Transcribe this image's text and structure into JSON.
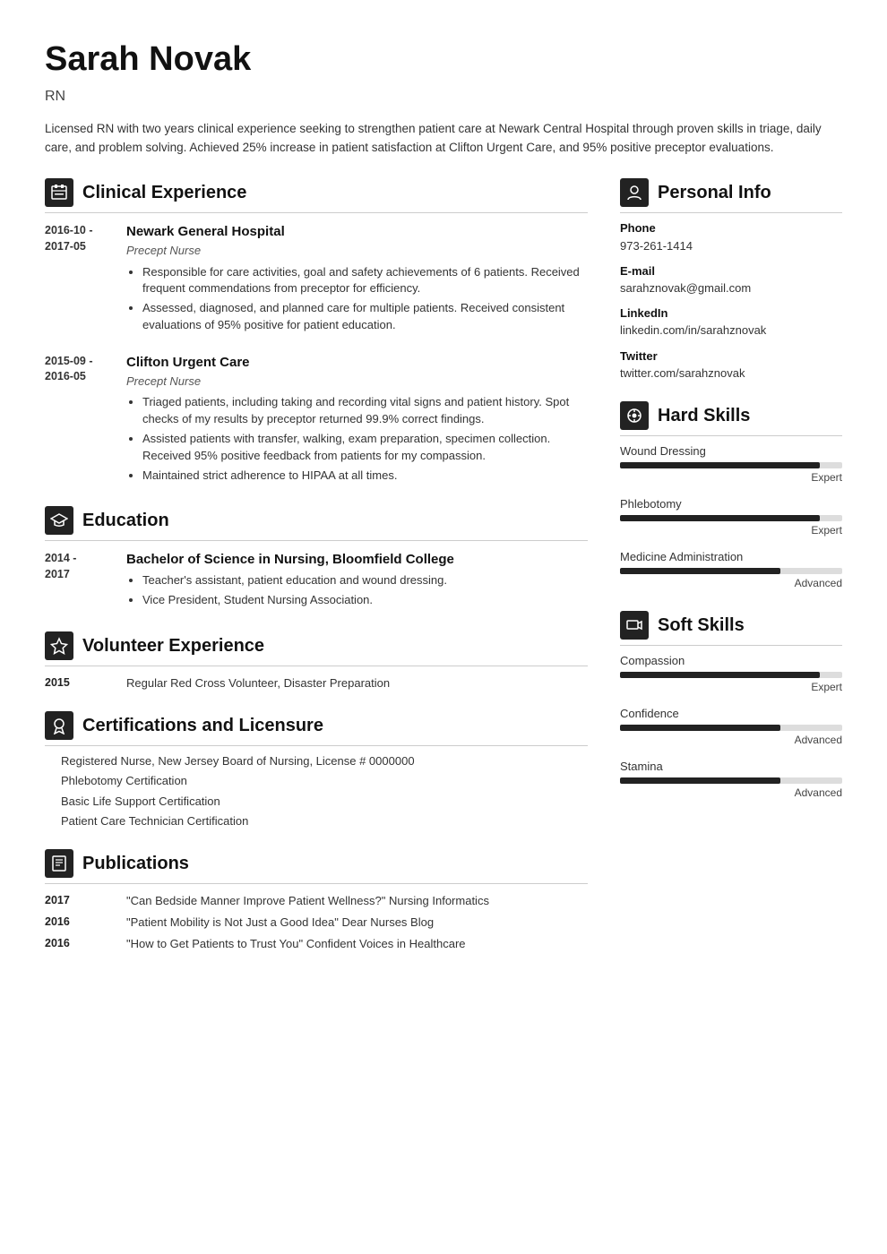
{
  "header": {
    "name": "Sarah Novak",
    "title": "RN",
    "summary": "Licensed RN with two years clinical experience seeking to strengthen patient care at Newark Central Hospital through proven skills in triage, daily care, and problem solving. Achieved 25% increase in patient satisfaction at Clifton Urgent Care, and 95% positive preceptor evaluations."
  },
  "sections": {
    "clinical_experience": {
      "title": "Clinical Experience",
      "entries": [
        {
          "date": "2016-10 -\n2017-05",
          "org": "Newark General Hospital",
          "role": "Precept Nurse",
          "bullets": [
            "Responsible for care activities, goal and safety achievements of 6 patients. Received frequent commendations from preceptor for efficiency.",
            "Assessed, diagnosed, and planned care for multiple patients. Received consistent evaluations of 95% positive for patient education."
          ]
        },
        {
          "date": "2015-09 -\n2016-05",
          "org": "Clifton Urgent Care",
          "role": "Precept Nurse",
          "bullets": [
            "Triaged patients, including taking and recording vital signs and patient history. Spot checks of my results by preceptor returned 99.9% correct findings.",
            "Assisted patients with transfer, walking, exam preparation, specimen collection. Received 95% positive feedback from patients for my compassion.",
            "Maintained strict adherence to HIPAA at all times."
          ]
        }
      ]
    },
    "education": {
      "title": "Education",
      "entries": [
        {
          "date": "2014 -\n2017",
          "title": "Bachelor of Science in Nursing, Bloomfield College",
          "bullets": [
            "Teacher's assistant, patient education and wound dressing.",
            "Vice President, Student Nursing Association."
          ]
        }
      ]
    },
    "volunteer": {
      "title": "Volunteer Experience",
      "entries": [
        {
          "date": "2015",
          "text": "Regular Red Cross Volunteer, Disaster Preparation"
        }
      ]
    },
    "certifications": {
      "title": "Certifications and Licensure",
      "items": [
        "Registered Nurse, New Jersey Board of Nursing, License # 0000000",
        "Phlebotomy Certification",
        "Basic Life Support Certification",
        "Patient Care Technician Certification"
      ]
    },
    "publications": {
      "title": "Publications",
      "entries": [
        {
          "year": "2017",
          "text": "\"Can Bedside Manner Improve Patient Wellness?\" Nursing Informatics"
        },
        {
          "year": "2016",
          "text": "\"Patient Mobility is Not Just a Good Idea\" Dear Nurses Blog"
        },
        {
          "year": "2016",
          "text": "\"How to Get Patients to Trust You\" Confident Voices in Healthcare"
        }
      ]
    }
  },
  "right": {
    "personal_info": {
      "title": "Personal Info",
      "items": [
        {
          "label": "Phone",
          "value": "973-261-1414"
        },
        {
          "label": "E-mail",
          "value": "sarahznovak@gmail.com"
        },
        {
          "label": "LinkedIn",
          "value": "linkedin.com/in/sarahznovak"
        },
        {
          "label": "Twitter",
          "value": "twitter.com/sarahznovak"
        }
      ]
    },
    "hard_skills": {
      "title": "Hard Skills",
      "items": [
        {
          "name": "Wound Dressing",
          "level": "Expert",
          "pct": 90
        },
        {
          "name": "Phlebotomy",
          "level": "Expert",
          "pct": 90
        },
        {
          "name": "Medicine Administration",
          "level": "Advanced",
          "pct": 72
        }
      ]
    },
    "soft_skills": {
      "title": "Soft Skills",
      "items": [
        {
          "name": "Compassion",
          "level": "Expert",
          "pct": 90
        },
        {
          "name": "Confidence",
          "level": "Advanced",
          "pct": 72
        },
        {
          "name": "Stamina",
          "level": "Advanced",
          "pct": 72
        }
      ]
    }
  },
  "icons": {
    "clinical": "🗂",
    "education": "🎓",
    "volunteer": "⭐",
    "certifications": "🏅",
    "publications": "📋",
    "personal_info": "👤",
    "hard_skills": "🔧",
    "soft_skills": "🚩"
  }
}
